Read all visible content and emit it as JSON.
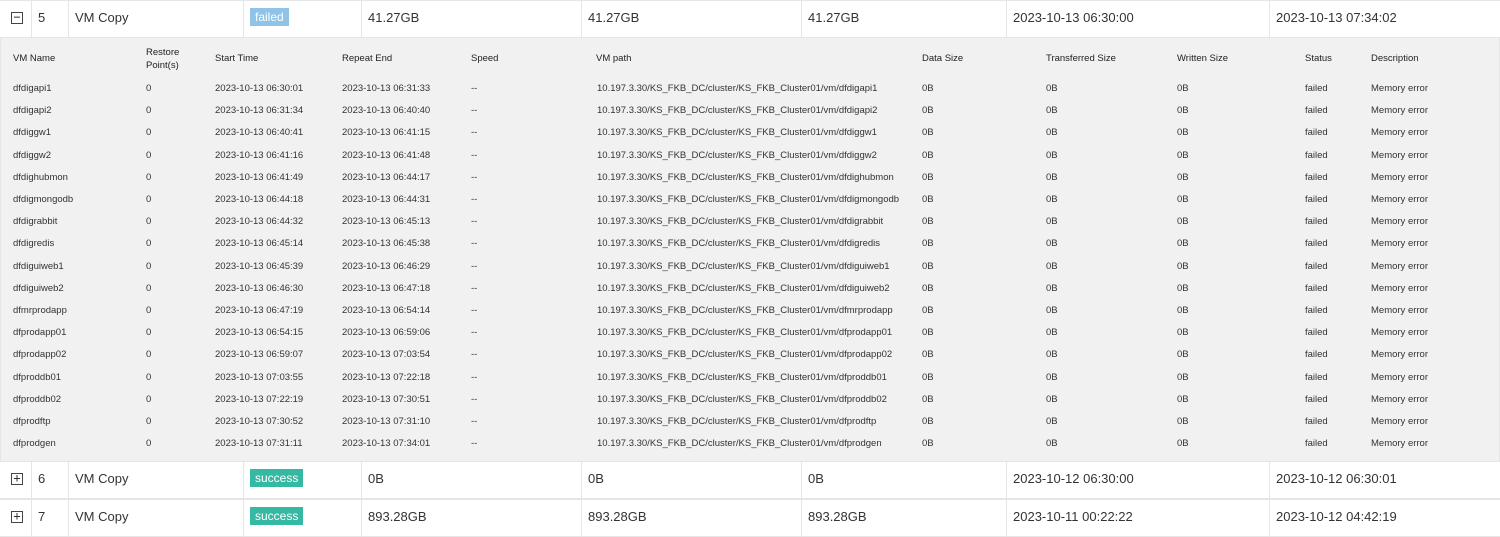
{
  "jobs": [
    {
      "toggle": "−",
      "id": "5",
      "type": "VM Copy",
      "status": "failed",
      "data_size": "41.27GB",
      "transferred": "41.27GB",
      "written": "41.27GB",
      "start": "2023-10-13 06:30:00",
      "end": "2023-10-13 07:34:02"
    },
    {
      "toggle": "+",
      "id": "6",
      "type": "VM Copy",
      "status": "success",
      "data_size": "0B",
      "transferred": "0B",
      "written": "0B",
      "start": "2023-10-12 06:30:00",
      "end": "2023-10-12 06:30:01"
    },
    {
      "toggle": "+",
      "id": "7",
      "type": "VM Copy",
      "status": "success",
      "data_size": "893.28GB",
      "transferred": "893.28GB",
      "written": "893.28GB",
      "start": "2023-10-11 00:22:22",
      "end": "2023-10-12 04:42:19"
    }
  ],
  "detail": {
    "headers": {
      "vm_name": "VM Name",
      "restore_points_1": "Restore",
      "restore_points_2": "Point(s)",
      "start_time": "Start Time",
      "repeat_end": "Repeat End",
      "speed": "Speed",
      "vm_path": "VM path",
      "data_size": "Data Size",
      "transferred_size": "Transferred Size",
      "written_size": "Written Size",
      "status": "Status",
      "description": "Description"
    },
    "rows": [
      {
        "name": "dfdigapi1",
        "rp": "0",
        "start": "2023-10-13 06:30:01",
        "end": "2023-10-13 06:31:33",
        "speed": "--",
        "path": "10.197.3.30/KS_FKB_DC/cluster/KS_FKB_Cluster01/vm/dfdigapi1",
        "data": "0B",
        "trans": "0B",
        "written": "0B",
        "status": "failed",
        "desc": "Memory error"
      },
      {
        "name": "dfdigapi2",
        "rp": "0",
        "start": "2023-10-13 06:31:34",
        "end": "2023-10-13 06:40:40",
        "speed": "--",
        "path": "10.197.3.30/KS_FKB_DC/cluster/KS_FKB_Cluster01/vm/dfdigapi2",
        "data": "0B",
        "trans": "0B",
        "written": "0B",
        "status": "failed",
        "desc": "Memory error"
      },
      {
        "name": "dfdiggw1",
        "rp": "0",
        "start": "2023-10-13 06:40:41",
        "end": "2023-10-13 06:41:15",
        "speed": "--",
        "path": "10.197.3.30/KS_FKB_DC/cluster/KS_FKB_Cluster01/vm/dfdiggw1",
        "data": "0B",
        "trans": "0B",
        "written": "0B",
        "status": "failed",
        "desc": "Memory error"
      },
      {
        "name": "dfdiggw2",
        "rp": "0",
        "start": "2023-10-13 06:41:16",
        "end": "2023-10-13 06:41:48",
        "speed": "--",
        "path": "10.197.3.30/KS_FKB_DC/cluster/KS_FKB_Cluster01/vm/dfdiggw2",
        "data": "0B",
        "trans": "0B",
        "written": "0B",
        "status": "failed",
        "desc": "Memory error"
      },
      {
        "name": "dfdighubmon",
        "rp": "0",
        "start": "2023-10-13 06:41:49",
        "end": "2023-10-13 06:44:17",
        "speed": "--",
        "path": "10.197.3.30/KS_FKB_DC/cluster/KS_FKB_Cluster01/vm/dfdighubmon",
        "data": "0B",
        "trans": "0B",
        "written": "0B",
        "status": "failed",
        "desc": "Memory error"
      },
      {
        "name": "dfdigmongodb",
        "rp": "0",
        "start": "2023-10-13 06:44:18",
        "end": "2023-10-13 06:44:31",
        "speed": "--",
        "path": "10.197.3.30/KS_FKB_DC/cluster/KS_FKB_Cluster01/vm/dfdigmongodb",
        "data": "0B",
        "trans": "0B",
        "written": "0B",
        "status": "failed",
        "desc": "Memory error"
      },
      {
        "name": "dfdigrabbit",
        "rp": "0",
        "start": "2023-10-13 06:44:32",
        "end": "2023-10-13 06:45:13",
        "speed": "--",
        "path": "10.197.3.30/KS_FKB_DC/cluster/KS_FKB_Cluster01/vm/dfdigrabbit",
        "data": "0B",
        "trans": "0B",
        "written": "0B",
        "status": "failed",
        "desc": "Memory error"
      },
      {
        "name": "dfdigredis",
        "rp": "0",
        "start": "2023-10-13 06:45:14",
        "end": "2023-10-13 06:45:38",
        "speed": "--",
        "path": "10.197.3.30/KS_FKB_DC/cluster/KS_FKB_Cluster01/vm/dfdigredis",
        "data": "0B",
        "trans": "0B",
        "written": "0B",
        "status": "failed",
        "desc": "Memory error"
      },
      {
        "name": "dfdiguiweb1",
        "rp": "0",
        "start": "2023-10-13 06:45:39",
        "end": "2023-10-13 06:46:29",
        "speed": "--",
        "path": "10.197.3.30/KS_FKB_DC/cluster/KS_FKB_Cluster01/vm/dfdiguiweb1",
        "data": "0B",
        "trans": "0B",
        "written": "0B",
        "status": "failed",
        "desc": "Memory error"
      },
      {
        "name": "dfdiguiweb2",
        "rp": "0",
        "start": "2023-10-13 06:46:30",
        "end": "2023-10-13 06:47:18",
        "speed": "--",
        "path": "10.197.3.30/KS_FKB_DC/cluster/KS_FKB_Cluster01/vm/dfdiguiweb2",
        "data": "0B",
        "trans": "0B",
        "written": "0B",
        "status": "failed",
        "desc": "Memory error"
      },
      {
        "name": "dfmrprodapp",
        "rp": "0",
        "start": "2023-10-13 06:47:19",
        "end": "2023-10-13 06:54:14",
        "speed": "--",
        "path": "10.197.3.30/KS_FKB_DC/cluster/KS_FKB_Cluster01/vm/dfmrprodapp",
        "data": "0B",
        "trans": "0B",
        "written": "0B",
        "status": "failed",
        "desc": "Memory error"
      },
      {
        "name": "dfprodapp01",
        "rp": "0",
        "start": "2023-10-13 06:54:15",
        "end": "2023-10-13 06:59:06",
        "speed": "--",
        "path": "10.197.3.30/KS_FKB_DC/cluster/KS_FKB_Cluster01/vm/dfprodapp01",
        "data": "0B",
        "trans": "0B",
        "written": "0B",
        "status": "failed",
        "desc": "Memory error"
      },
      {
        "name": "dfprodapp02",
        "rp": "0",
        "start": "2023-10-13 06:59:07",
        "end": "2023-10-13 07:03:54",
        "speed": "--",
        "path": "10.197.3.30/KS_FKB_DC/cluster/KS_FKB_Cluster01/vm/dfprodapp02",
        "data": "0B",
        "trans": "0B",
        "written": "0B",
        "status": "failed",
        "desc": "Memory error"
      },
      {
        "name": "dfproddb01",
        "rp": "0",
        "start": "2023-10-13 07:03:55",
        "end": "2023-10-13 07:22:18",
        "speed": "--",
        "path": "10.197.3.30/KS_FKB_DC/cluster/KS_FKB_Cluster01/vm/dfproddb01",
        "data": "0B",
        "trans": "0B",
        "written": "0B",
        "status": "failed",
        "desc": "Memory error"
      },
      {
        "name": "dfproddb02",
        "rp": "0",
        "start": "2023-10-13 07:22:19",
        "end": "2023-10-13 07:30:51",
        "speed": "--",
        "path": "10.197.3.30/KS_FKB_DC/cluster/KS_FKB_Cluster01/vm/dfproddb02",
        "data": "0B",
        "trans": "0B",
        "written": "0B",
        "status": "failed",
        "desc": "Memory error"
      },
      {
        "name": "dfprodftp",
        "rp": "0",
        "start": "2023-10-13 07:30:52",
        "end": "2023-10-13 07:31:10",
        "speed": "--",
        "path": "10.197.3.30/KS_FKB_DC/cluster/KS_FKB_Cluster01/vm/dfprodftp",
        "data": "0B",
        "trans": "0B",
        "written": "0B",
        "status": "failed",
        "desc": "Memory error"
      },
      {
        "name": "dfprodgen",
        "rp": "0",
        "start": "2023-10-13 07:31:11",
        "end": "2023-10-13 07:34:01",
        "speed": "--",
        "path": "10.197.3.30/KS_FKB_DC/cluster/KS_FKB_Cluster01/vm/dfprodgen",
        "data": "0B",
        "trans": "0B",
        "written": "0B",
        "status": "failed",
        "desc": "Memory error"
      }
    ]
  }
}
